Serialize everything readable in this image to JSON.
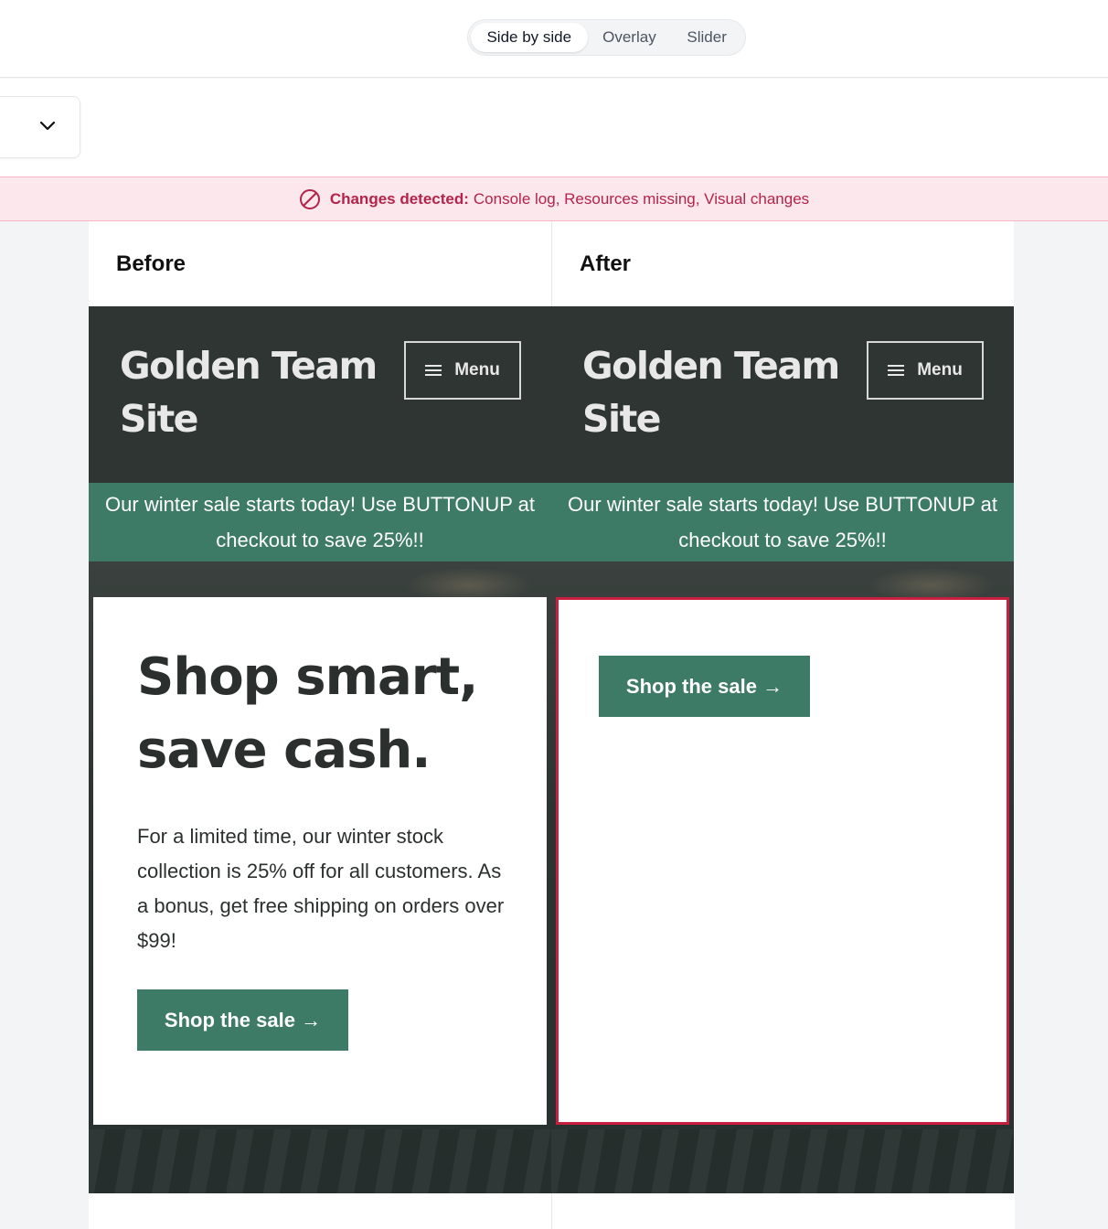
{
  "view_modes": {
    "side_by_side": "Side by side",
    "overlay": "Overlay",
    "slider": "Slider",
    "selected": "Side by side"
  },
  "alert": {
    "title": "Changes detected:",
    "details": "Console log, Resources missing, Visual changes",
    "color": "#b4234a"
  },
  "before": {
    "label": "Before",
    "site_title": "Golden Team Site",
    "menu_label": "Menu",
    "promo": "Our winter sale starts today! Use BUTTONUP at checkout to save 25%!!",
    "heading": "Shop smart, save cash.",
    "body": "For a limited time, our winter stock collection is 25% off for all customers. As a bonus, get free shipping on orders over $99!",
    "cta": "Shop the sale →"
  },
  "after": {
    "label": "After",
    "site_title": "Golden Team Site",
    "menu_label": "Menu",
    "promo": "Our winter sale starts today! Use BUTTONUP at checkout to save 25%!!",
    "cta": "Shop the sale →"
  },
  "colors": {
    "site_header": "#2e3532",
    "promo_bar": "#3d7b66",
    "diff_highlight": "#c81e3f"
  }
}
